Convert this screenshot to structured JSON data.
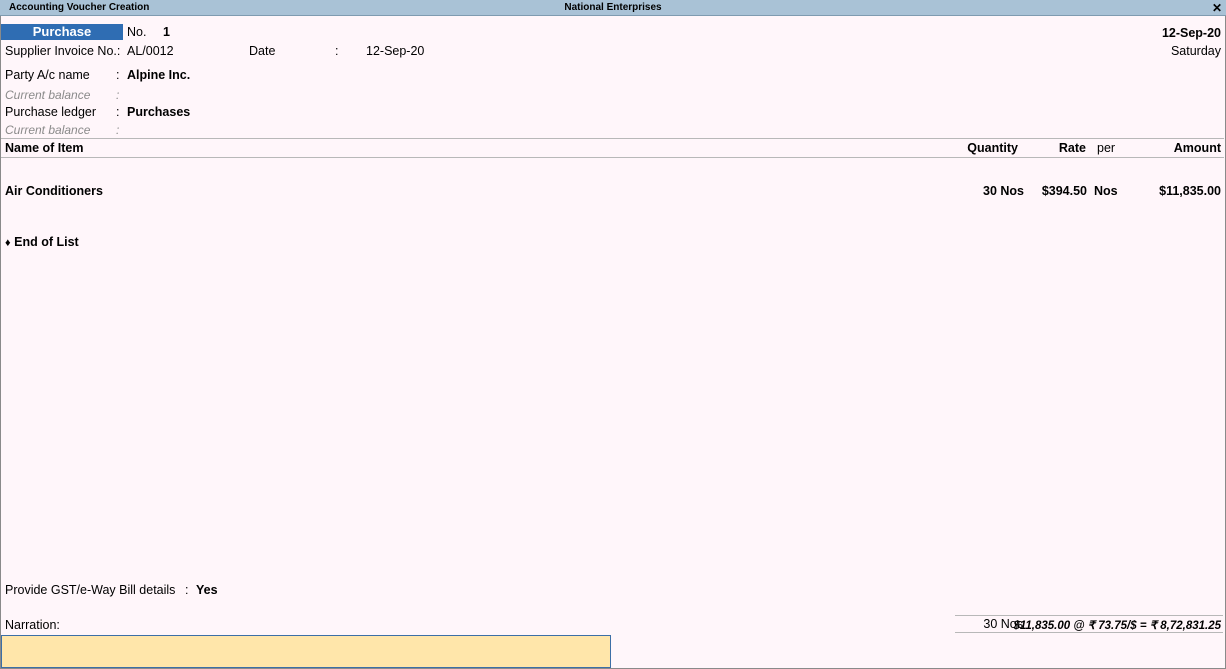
{
  "window": {
    "title": "Accounting Voucher Creation",
    "company": "National Enterprises",
    "close_glyph": "✕"
  },
  "voucher": {
    "type": "Purchase",
    "no_label": "No.",
    "no_value": "1",
    "date": "12-Sep-20",
    "day": "Saturday"
  },
  "supplier": {
    "invoice_label": "Supplier Invoice No.:",
    "invoice_value": "AL/0012",
    "date_label": "Date",
    "date_colon": ":",
    "date_value": "12-Sep-20"
  },
  "party": {
    "label": "Party A/c name",
    "colon": ":",
    "value": "Alpine Inc.",
    "balance_label": "Current balance",
    "balance_colon": ":"
  },
  "purchase_ledger": {
    "label": "Purchase ledger",
    "colon": ":",
    "value": "Purchases",
    "balance_label": "Current balance",
    "balance_colon": ":"
  },
  "table": {
    "headers": {
      "name": "Name of Item",
      "quantity": "Quantity",
      "rate": "Rate",
      "per": "per",
      "amount": "Amount"
    },
    "rows": [
      {
        "name": "Air Conditioners",
        "quantity": "30 Nos",
        "rate": "$394.50",
        "per": "Nos",
        "amount": "$11,835.00"
      }
    ],
    "end_of_list_glyph": "♦",
    "end_of_list": "End of List"
  },
  "gst": {
    "label": "Provide GST/e-Way Bill details",
    "colon": ":",
    "value": "Yes"
  },
  "narration": {
    "label": "Narration:",
    "value": ""
  },
  "totals": {
    "quantity": "30 Nos",
    "amount_expression": "$11,835.00 @ ₹ 73.75/$ = ₹ 8,72,831.25"
  }
}
